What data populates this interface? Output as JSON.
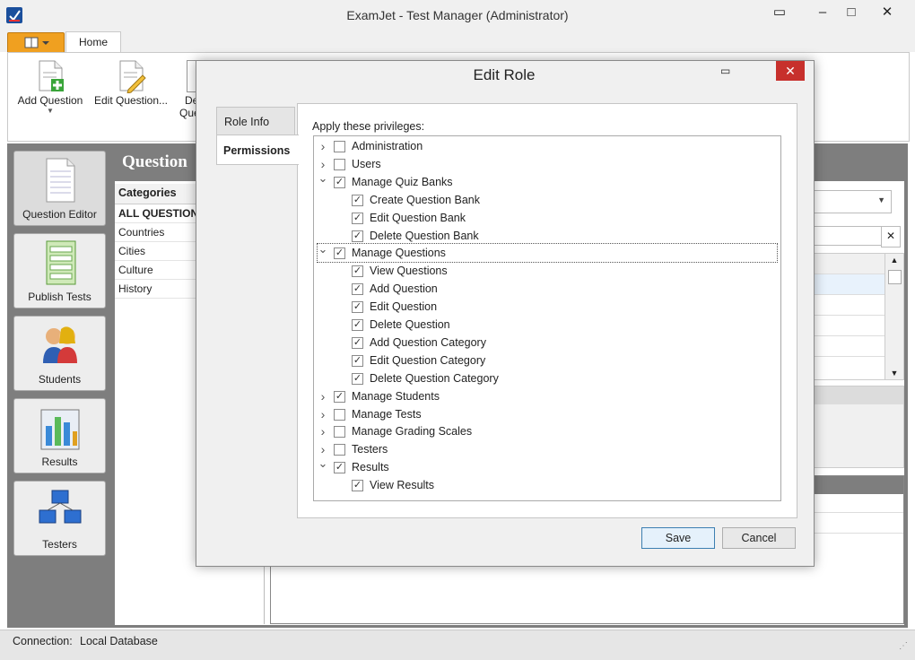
{
  "app": {
    "title": "ExamJet - Test Manager (Administrator)"
  },
  "ribbon": {
    "tab_home": "Home",
    "add_question": "Add Question",
    "edit_question": "Edit Question...",
    "delete_question_1": "De",
    "delete_question_2": "Que"
  },
  "nav": {
    "items": [
      {
        "label": "Question Editor"
      },
      {
        "label": "Publish Tests"
      },
      {
        "label": "Students"
      },
      {
        "label": "Results"
      },
      {
        "label": "Testers"
      }
    ]
  },
  "content": {
    "title": "Question",
    "categories_header": "Categories",
    "categories": [
      "ALL QUESTION",
      "Countries",
      "Cities",
      "Culture",
      "History"
    ]
  },
  "status": {
    "connection_label": "Connection:",
    "connection_value": "Local Database"
  },
  "dialog": {
    "title": "Edit Role",
    "tabs": {
      "role_info": "Role Info",
      "permissions": "Permissions"
    },
    "apply_label": "Apply these privileges:",
    "save": "Save",
    "cancel": "Cancel",
    "tree": [
      {
        "label": "Administration",
        "level": 0,
        "checked": false,
        "expanded": false
      },
      {
        "label": "Users",
        "level": 0,
        "checked": false,
        "expanded": false
      },
      {
        "label": "Manage Quiz Banks",
        "level": 0,
        "checked": true,
        "expanded": true
      },
      {
        "label": "Create Question Bank",
        "level": 1,
        "checked": true
      },
      {
        "label": "Edit Question Bank",
        "level": 1,
        "checked": true
      },
      {
        "label": "Delete Question Bank",
        "level": 1,
        "checked": true
      },
      {
        "label": "Manage Questions",
        "level": 0,
        "checked": true,
        "expanded": true,
        "focused": true
      },
      {
        "label": "View Questions",
        "level": 1,
        "checked": true
      },
      {
        "label": "Add Question",
        "level": 1,
        "checked": true
      },
      {
        "label": "Edit Question",
        "level": 1,
        "checked": true
      },
      {
        "label": "Delete Question",
        "level": 1,
        "checked": true
      },
      {
        "label": "Add Question Category",
        "level": 1,
        "checked": true
      },
      {
        "label": "Edit Question Category",
        "level": 1,
        "checked": true
      },
      {
        "label": "Delete Question Category",
        "level": 1,
        "checked": true
      },
      {
        "label": "Manage Students",
        "level": 0,
        "checked": true,
        "expanded": false
      },
      {
        "label": "Manage Tests",
        "level": 0,
        "checked": false,
        "expanded": false
      },
      {
        "label": "Manage Grading Scales",
        "level": 0,
        "checked": false,
        "expanded": false
      },
      {
        "label": "Testers",
        "level": 0,
        "checked": false,
        "expanded": false
      },
      {
        "label": "Results",
        "level": 0,
        "checked": true,
        "expanded": true
      },
      {
        "label": "View Results",
        "level": 1,
        "checked": true
      }
    ]
  }
}
